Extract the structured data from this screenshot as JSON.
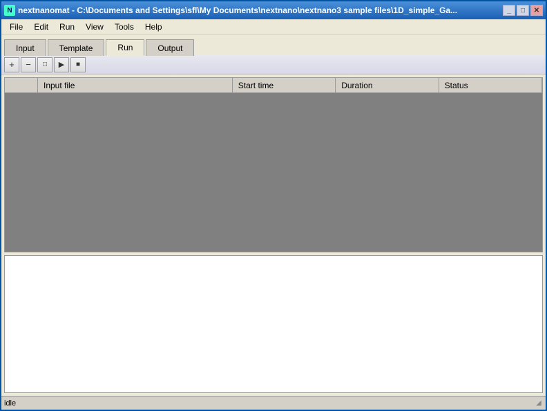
{
  "window": {
    "title": "nextnanomat - C:\\Documents and Settings\\sfl\\My Documents\\nextnano\\nextnano3 sample files\\1D_simple_Ga...",
    "icon": "N"
  },
  "titlebar": {
    "minimize_label": "_",
    "maximize_label": "□",
    "close_label": "✕"
  },
  "menu": {
    "items": [
      {
        "label": "File"
      },
      {
        "label": "Edit"
      },
      {
        "label": "Run"
      },
      {
        "label": "View"
      },
      {
        "label": "Tools"
      },
      {
        "label": "Help"
      }
    ]
  },
  "tabs": [
    {
      "label": "Input",
      "active": false
    },
    {
      "label": "Template",
      "active": false
    },
    {
      "label": "Run",
      "active": true
    },
    {
      "label": "Output",
      "active": false
    }
  ],
  "toolbar": {
    "add_label": "+",
    "remove_label": "−",
    "stop_label": "□",
    "play_label": "▶",
    "pause_label": "■"
  },
  "table": {
    "columns": [
      {
        "label": "Input file"
      },
      {
        "label": "Start time"
      },
      {
        "label": "Duration"
      },
      {
        "label": "Status"
      }
    ],
    "rows": []
  },
  "log": {
    "content": ""
  },
  "statusbar": {
    "text": "idle",
    "grip": "◢"
  }
}
